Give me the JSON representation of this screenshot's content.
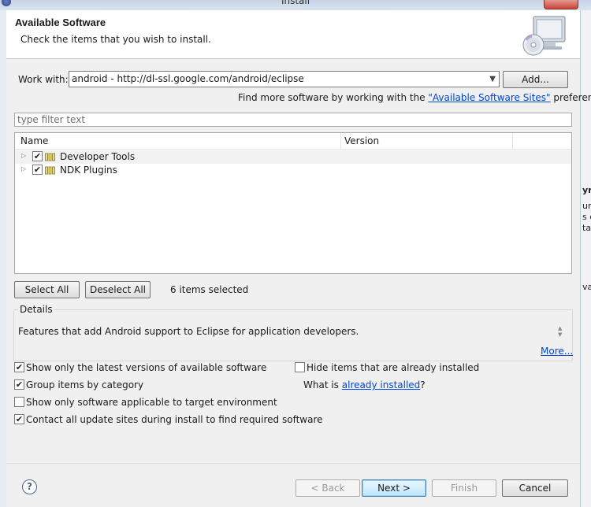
{
  "window": {
    "title": "Install"
  },
  "banner": {
    "title": "Available Software",
    "subtitle": "Check the items that you wish to install."
  },
  "work_with": {
    "label": "Work with:",
    "value": "android - http://dl-ssl.google.com/android/eclipse",
    "add_label": "Add..."
  },
  "find_more": {
    "prefix": "Find more software by working with the ",
    "link": "\"Available Software Sites\"",
    "suffix": " preferences."
  },
  "filter": {
    "placeholder": "type filter text"
  },
  "tree": {
    "columns": [
      "Name",
      "Version"
    ],
    "rows": [
      {
        "label": "Developer Tools",
        "checked": true
      },
      {
        "label": "NDK Plugins",
        "checked": true
      }
    ]
  },
  "selection": {
    "select_all": "Select All",
    "deselect_all": "Deselect All",
    "count_text": "6 items selected"
  },
  "details": {
    "legend": "Details",
    "text": "Features that add Android support to Eclipse for application developers.",
    "more": "More..."
  },
  "options": {
    "latest_only": "Show only the latest versions of available software",
    "group_by_category": "Group items by category",
    "applicable_only": "Show only software applicable to target environment",
    "contact_sites": "Contact all update sites during install to find required software",
    "hide_installed": "Hide items that are already installed",
    "what_is_prefix": "What is ",
    "what_is_link": "already installed",
    "what_is_suffix": "?"
  },
  "footer": {
    "help": "?",
    "back": "< Back",
    "next": "Next >",
    "finish": "Finish",
    "cancel": "Cancel"
  },
  "background": {
    "text_fragments": [
      "yr",
      "ur",
      "s c",
      "ta",
      "vai"
    ]
  }
}
